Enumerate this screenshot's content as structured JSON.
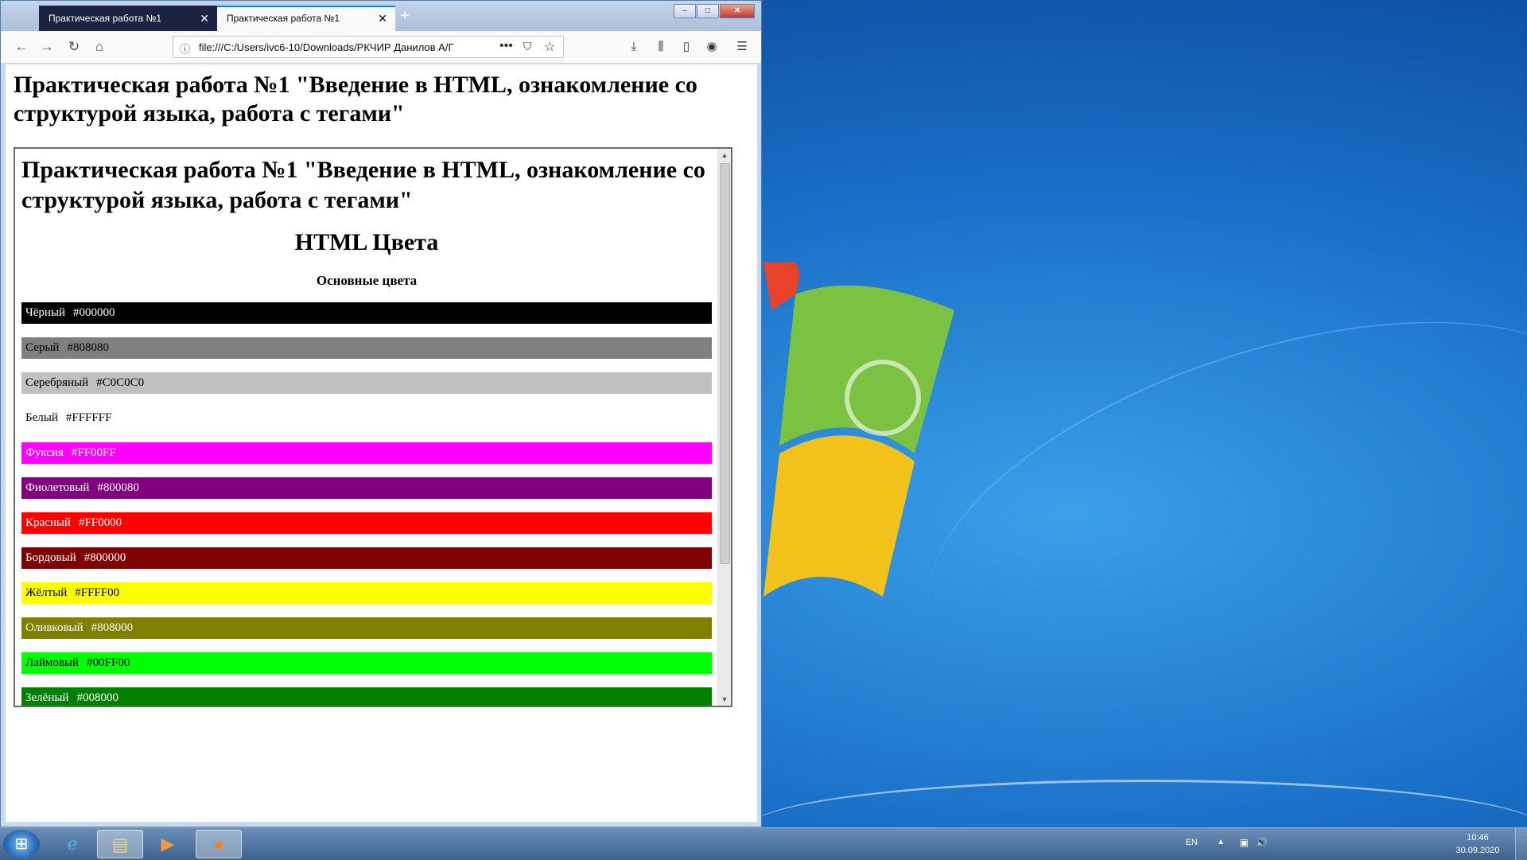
{
  "browser": {
    "tabs": [
      {
        "label": "Практическая работа №1",
        "active": false
      },
      {
        "label": "Практическая работа №1",
        "active": true
      }
    ],
    "url": "file:///C:/Users/ivc6-10/Downloads/РКЧИР Данилов А/Г",
    "window_buttons": {
      "minimize": "–",
      "maximize": "□",
      "close": "✕"
    }
  },
  "page": {
    "title": "Практическая работа №1 \"Введение в HTML, ознакомление со структурой языка, работа с тегами\""
  },
  "iframe": {
    "title": "Практическая работа №1 \"Введение в HTML, ознакомление со структурой языка, работа с тегами\"",
    "heading": "HTML Цвета",
    "subheading": "Основные цвета",
    "colors": [
      {
        "name": "Чёрный",
        "hex": "#000000",
        "text_color": "#ffffff"
      },
      {
        "name": "Серый",
        "hex": "#808080",
        "text_color": "#000000"
      },
      {
        "name": "Серебряный",
        "hex": "#C0C0C0",
        "text_color": "#000000"
      },
      {
        "name": "Белый",
        "hex": "#FFFFFF",
        "text_color": "#000000"
      },
      {
        "name": "Фуксия",
        "hex": "#FF00FF",
        "text_color": "#ffffff"
      },
      {
        "name": "Фиолетовый",
        "hex": "#800080",
        "text_color": "#ffffff"
      },
      {
        "name": "Красный",
        "hex": "#FF0000",
        "text_color": "#ffffff"
      },
      {
        "name": "Бордовый",
        "hex": "#800000",
        "text_color": "#ffffff"
      },
      {
        "name": "Жёлтый",
        "hex": "#FFFF00",
        "text_color": "#000000"
      },
      {
        "name": "Оливковый",
        "hex": "#808000",
        "text_color": "#ffffff"
      },
      {
        "name": "Лаймовый",
        "hex": "#00FF00",
        "text_color": "#000000"
      },
      {
        "name": "Зелёный",
        "hex": "#008000",
        "text_color": "#ffffff"
      }
    ]
  },
  "taskbar": {
    "apps": [
      "internet-explorer",
      "file-explorer",
      "media-player",
      "firefox"
    ],
    "language": "EN",
    "time": "10:46",
    "date": "30.09.2020"
  }
}
